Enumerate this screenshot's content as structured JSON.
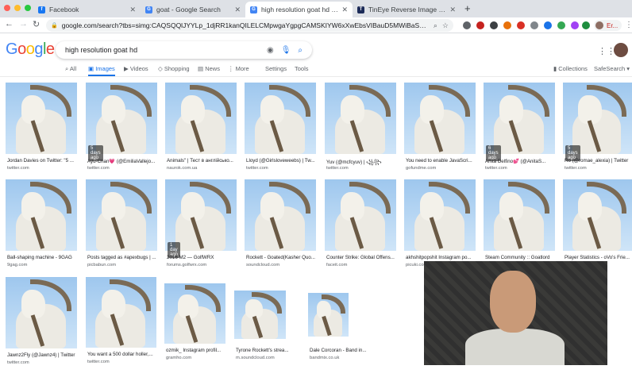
{
  "browser": {
    "tabs": [
      {
        "title": "Facebook",
        "favicon": "facebook-icon",
        "color": "#1877f2"
      },
      {
        "title": "goat - Google Search",
        "favicon": "google-icon",
        "color": "#4285f4"
      },
      {
        "title": "high resolution goat hd - Goog",
        "favicon": "google-icon",
        "color": "#4285f4",
        "active": true
      },
      {
        "title": "TinEye Reverse Image Search",
        "favicon": "tineye-icon",
        "color": "#1c2b58"
      }
    ],
    "url": "google.com/search?tbs=simg:CAQSQQlJYYLp_1djRR1kanQILELCMpwgaYgpgCAMSKIYW6xXwEbsVIBauD5MWiBaSFpEGri...",
    "profile_name": "Er..."
  },
  "google": {
    "logo": "Google",
    "query": "high resolution goat hd",
    "tabs": [
      "All",
      "Images",
      "Videos",
      "Shopping",
      "News",
      "More"
    ],
    "active_tab": "Images",
    "settings": "Settings",
    "tools": "Tools",
    "collections": "Collections",
    "safesearch": "SafeSearch ▾"
  },
  "results": [
    {
      "caption": "Jordan Davies on Twitter: \"5 ...",
      "source": "twitter.com",
      "badge": ""
    },
    {
      "caption": "Ayu-Chan💗 (@EmiliaVallejo...",
      "source": "twitter.com",
      "badge": "5 days ago"
    },
    {
      "caption": "Animals\" | Тест в англійсько...",
      "source": "naurok.com.ua",
      "badge": ""
    },
    {
      "caption": "Lloyd (@Girlsloveweebs) | Tw...",
      "source": "twitter.com",
      "badge": ""
    },
    {
      "caption": "Yuv (@mcfcyuv) | ꧁꧂",
      "source": "twitter.com",
      "badge": ""
    },
    {
      "caption": "You need to enable JavaScri...",
      "source": "gofundme.com",
      "badge": ""
    },
    {
      "caption": "Anita Delfino💕 (@AnitaS...",
      "source": "twitter.com",
      "badge": "6 days ago"
    },
    {
      "caption": "Ro (@romae_alexia) | Twitter",
      "source": "twitter.com",
      "badge": "5 days ago"
    },
    {
      "caption": "Ball-shaping machine - 9GAG",
      "source": "9gag.com",
      "badge": ""
    },
    {
      "caption": "Posts tagged as #apexbugs | ...",
      "source": "picbabun.com",
      "badge": ""
    },
    {
      "caption": "2016 M2 — GolfWRX",
      "source": "forums.golfwrx.com",
      "badge": "1 day ago"
    },
    {
      "caption": "Rockett - Goated(Kasher Quo...",
      "source": "soundcloud.com",
      "badge": ""
    },
    {
      "caption": "Counter Strike: Global Offens...",
      "source": "faceit.com",
      "badge": ""
    },
    {
      "caption": "akhshitpopshit Instagram po...",
      "source": "picuki.com",
      "badge": ""
    },
    {
      "caption": "Steam Community :: Goatlord",
      "source": "steamcommunity.com",
      "badge": ""
    },
    {
      "caption": "Player Statistics - oVo's Frie...",
      "source": "challengermode.com",
      "badge": ""
    },
    {
      "caption": "Jawnz2Fly (@Jawnz4) | Twitter",
      "source": "twitter.com",
      "badge": ""
    },
    {
      "caption": "You want a 500 dollar holler,...",
      "source": "twitter.com",
      "badge": ""
    },
    {
      "caption": "ozmik_ Instagram profil...",
      "source": "gramho.com",
      "badge": ""
    },
    {
      "caption": "Tyrone Rockett's strea...",
      "source": "m.soundcloud.com",
      "badge": ""
    },
    {
      "caption": "Dale Corcoran - Band in...",
      "source": "bandmix.co.uk",
      "badge": ""
    }
  ],
  "colors": {
    "accent": "#1a73e8",
    "tab_bar": "#dee1e6"
  }
}
